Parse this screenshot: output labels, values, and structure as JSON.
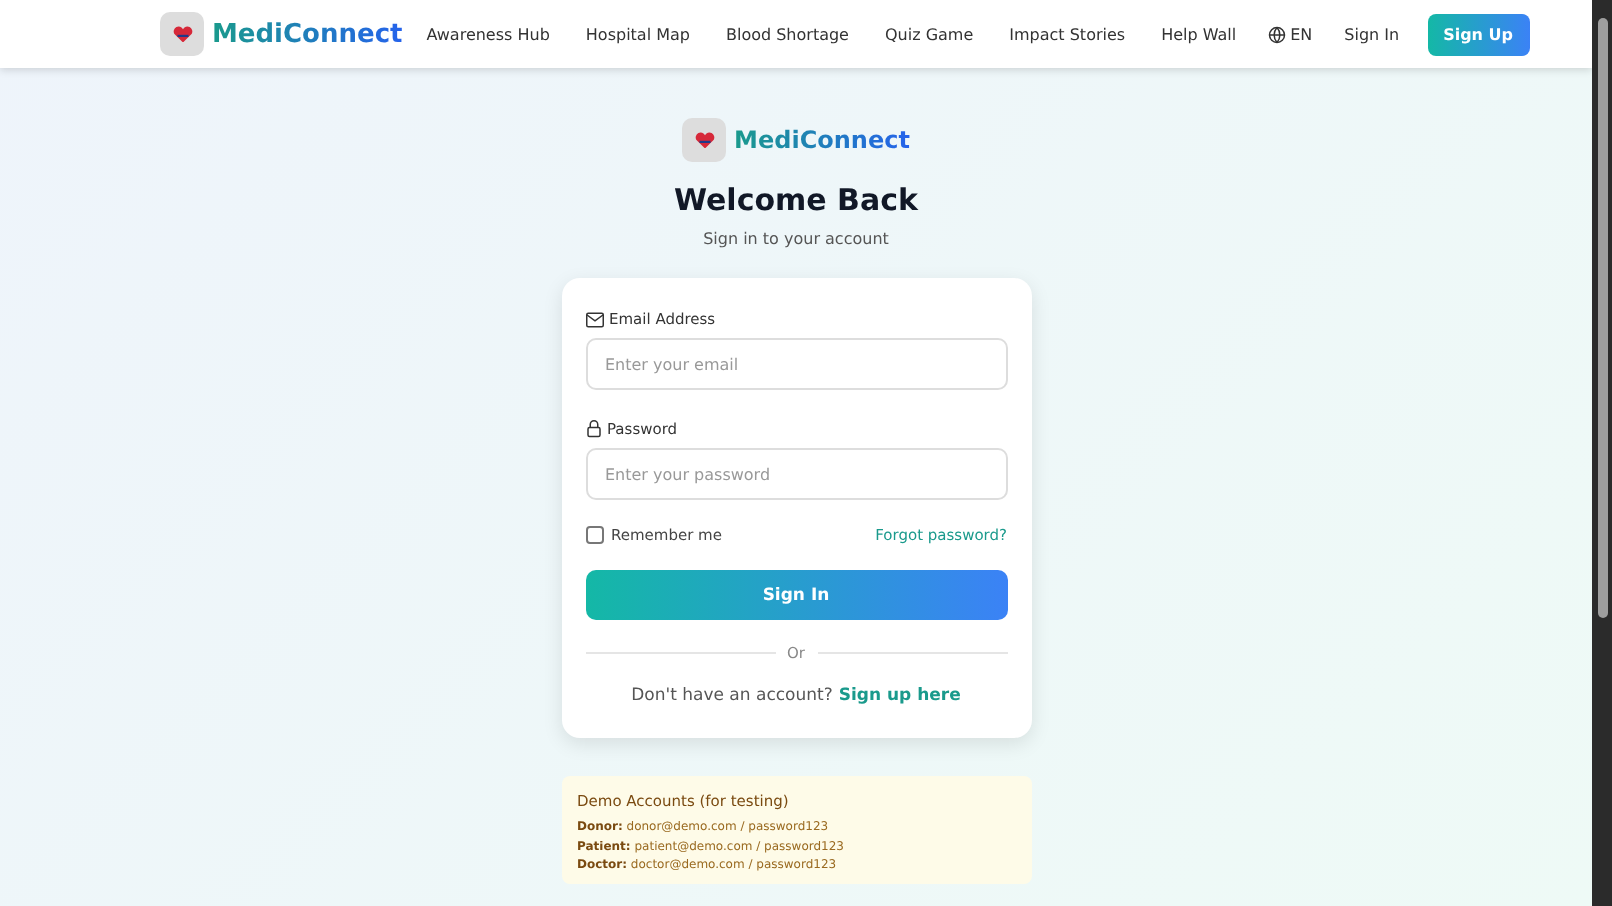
{
  "navbar": {
    "brand": "MediConnect",
    "links": [
      "Awareness Hub",
      "Hospital Map",
      "Blood Shortage",
      "Quiz Game",
      "Impact Stories",
      "Help Wall"
    ],
    "language": "EN",
    "sign_in": "Sign In",
    "sign_up": "Sign Up"
  },
  "header": {
    "brand": "MediConnect",
    "title": "Welcome Back",
    "subtitle": "Sign in to your account"
  },
  "form": {
    "email": {
      "label": "Email Address",
      "placeholder": "Enter your email"
    },
    "password": {
      "label": "Password",
      "placeholder": "Enter your password"
    },
    "remember": {
      "label": "Remember me",
      "checked": false
    },
    "forgot": "Forgot password?",
    "submit": "Sign In",
    "divider": "Or",
    "signup_prompt": "Don't have an account?",
    "signup_link": "Sign up here"
  },
  "demo": {
    "title": "Demo Accounts (for testing)",
    "lines": [
      "**Donor:** donor@demo.com / password123",
      "**Patient:** patient@demo.com / password123",
      "**Doctor:** doctor@demo.com / password123"
    ]
  }
}
